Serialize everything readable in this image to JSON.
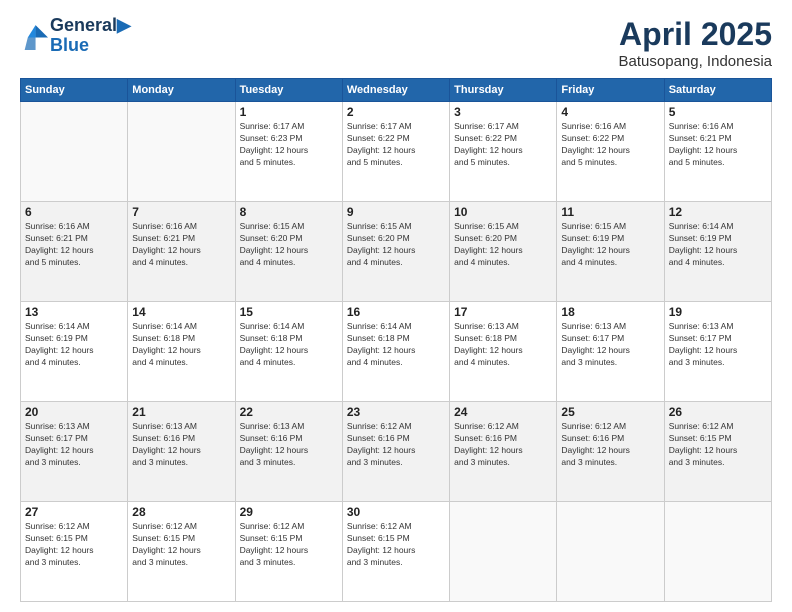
{
  "header": {
    "logo_line1": "General",
    "logo_line2": "Blue",
    "title": "April 2025",
    "subtitle": "Batusopang, Indonesia"
  },
  "weekdays": [
    "Sunday",
    "Monday",
    "Tuesday",
    "Wednesday",
    "Thursday",
    "Friday",
    "Saturday"
  ],
  "weeks": [
    [
      {
        "day": "",
        "info": ""
      },
      {
        "day": "",
        "info": ""
      },
      {
        "day": "1",
        "info": "Sunrise: 6:17 AM\nSunset: 6:23 PM\nDaylight: 12 hours\nand 5 minutes."
      },
      {
        "day": "2",
        "info": "Sunrise: 6:17 AM\nSunset: 6:22 PM\nDaylight: 12 hours\nand 5 minutes."
      },
      {
        "day": "3",
        "info": "Sunrise: 6:17 AM\nSunset: 6:22 PM\nDaylight: 12 hours\nand 5 minutes."
      },
      {
        "day": "4",
        "info": "Sunrise: 6:16 AM\nSunset: 6:22 PM\nDaylight: 12 hours\nand 5 minutes."
      },
      {
        "day": "5",
        "info": "Sunrise: 6:16 AM\nSunset: 6:21 PM\nDaylight: 12 hours\nand 5 minutes."
      }
    ],
    [
      {
        "day": "6",
        "info": "Sunrise: 6:16 AM\nSunset: 6:21 PM\nDaylight: 12 hours\nand 5 minutes."
      },
      {
        "day": "7",
        "info": "Sunrise: 6:16 AM\nSunset: 6:21 PM\nDaylight: 12 hours\nand 4 minutes."
      },
      {
        "day": "8",
        "info": "Sunrise: 6:15 AM\nSunset: 6:20 PM\nDaylight: 12 hours\nand 4 minutes."
      },
      {
        "day": "9",
        "info": "Sunrise: 6:15 AM\nSunset: 6:20 PM\nDaylight: 12 hours\nand 4 minutes."
      },
      {
        "day": "10",
        "info": "Sunrise: 6:15 AM\nSunset: 6:20 PM\nDaylight: 12 hours\nand 4 minutes."
      },
      {
        "day": "11",
        "info": "Sunrise: 6:15 AM\nSunset: 6:19 PM\nDaylight: 12 hours\nand 4 minutes."
      },
      {
        "day": "12",
        "info": "Sunrise: 6:14 AM\nSunset: 6:19 PM\nDaylight: 12 hours\nand 4 minutes."
      }
    ],
    [
      {
        "day": "13",
        "info": "Sunrise: 6:14 AM\nSunset: 6:19 PM\nDaylight: 12 hours\nand 4 minutes."
      },
      {
        "day": "14",
        "info": "Sunrise: 6:14 AM\nSunset: 6:18 PM\nDaylight: 12 hours\nand 4 minutes."
      },
      {
        "day": "15",
        "info": "Sunrise: 6:14 AM\nSunset: 6:18 PM\nDaylight: 12 hours\nand 4 minutes."
      },
      {
        "day": "16",
        "info": "Sunrise: 6:14 AM\nSunset: 6:18 PM\nDaylight: 12 hours\nand 4 minutes."
      },
      {
        "day": "17",
        "info": "Sunrise: 6:13 AM\nSunset: 6:18 PM\nDaylight: 12 hours\nand 4 minutes."
      },
      {
        "day": "18",
        "info": "Sunrise: 6:13 AM\nSunset: 6:17 PM\nDaylight: 12 hours\nand 3 minutes."
      },
      {
        "day": "19",
        "info": "Sunrise: 6:13 AM\nSunset: 6:17 PM\nDaylight: 12 hours\nand 3 minutes."
      }
    ],
    [
      {
        "day": "20",
        "info": "Sunrise: 6:13 AM\nSunset: 6:17 PM\nDaylight: 12 hours\nand 3 minutes."
      },
      {
        "day": "21",
        "info": "Sunrise: 6:13 AM\nSunset: 6:16 PM\nDaylight: 12 hours\nand 3 minutes."
      },
      {
        "day": "22",
        "info": "Sunrise: 6:13 AM\nSunset: 6:16 PM\nDaylight: 12 hours\nand 3 minutes."
      },
      {
        "day": "23",
        "info": "Sunrise: 6:12 AM\nSunset: 6:16 PM\nDaylight: 12 hours\nand 3 minutes."
      },
      {
        "day": "24",
        "info": "Sunrise: 6:12 AM\nSunset: 6:16 PM\nDaylight: 12 hours\nand 3 minutes."
      },
      {
        "day": "25",
        "info": "Sunrise: 6:12 AM\nSunset: 6:16 PM\nDaylight: 12 hours\nand 3 minutes."
      },
      {
        "day": "26",
        "info": "Sunrise: 6:12 AM\nSunset: 6:15 PM\nDaylight: 12 hours\nand 3 minutes."
      }
    ],
    [
      {
        "day": "27",
        "info": "Sunrise: 6:12 AM\nSunset: 6:15 PM\nDaylight: 12 hours\nand 3 minutes."
      },
      {
        "day": "28",
        "info": "Sunrise: 6:12 AM\nSunset: 6:15 PM\nDaylight: 12 hours\nand 3 minutes."
      },
      {
        "day": "29",
        "info": "Sunrise: 6:12 AM\nSunset: 6:15 PM\nDaylight: 12 hours\nand 3 minutes."
      },
      {
        "day": "30",
        "info": "Sunrise: 6:12 AM\nSunset: 6:15 PM\nDaylight: 12 hours\nand 3 minutes."
      },
      {
        "day": "",
        "info": ""
      },
      {
        "day": "",
        "info": ""
      },
      {
        "day": "",
        "info": ""
      }
    ]
  ]
}
